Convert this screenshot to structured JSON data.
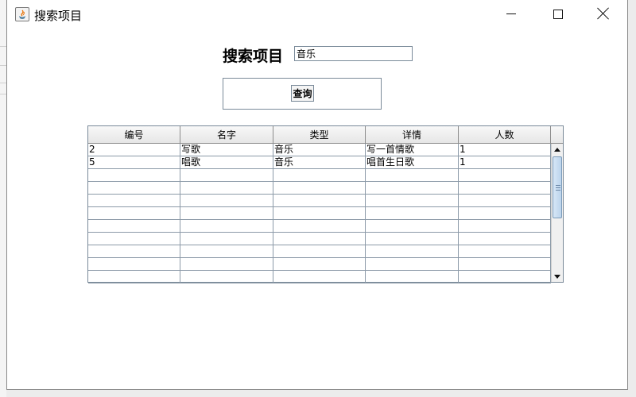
{
  "window": {
    "title": "搜索项目",
    "controls": [
      "minimize-icon",
      "maximize-icon",
      "close-icon"
    ]
  },
  "search": {
    "label": "搜索项目",
    "value": "音乐",
    "query_button": "查询"
  },
  "table": {
    "columns": [
      "编号",
      "名字",
      "类型",
      "详情",
      "人数"
    ],
    "rows": [
      [
        "2",
        "写歌",
        "音乐",
        "写一首情歌",
        "1"
      ],
      [
        "5",
        "唱歌",
        "音乐",
        "唱首生日歌",
        "1"
      ],
      [
        "",
        "",
        "",
        "",
        ""
      ],
      [
        "",
        "",
        "",
        "",
        ""
      ],
      [
        "",
        "",
        "",
        "",
        ""
      ],
      [
        "",
        "",
        "",
        "",
        ""
      ],
      [
        "",
        "",
        "",
        "",
        ""
      ],
      [
        "",
        "",
        "",
        "",
        ""
      ],
      [
        "",
        "",
        "",
        "",
        ""
      ],
      [
        "",
        "",
        "",
        "",
        ""
      ],
      [
        "",
        "",
        "",
        "",
        ""
      ]
    ]
  }
}
